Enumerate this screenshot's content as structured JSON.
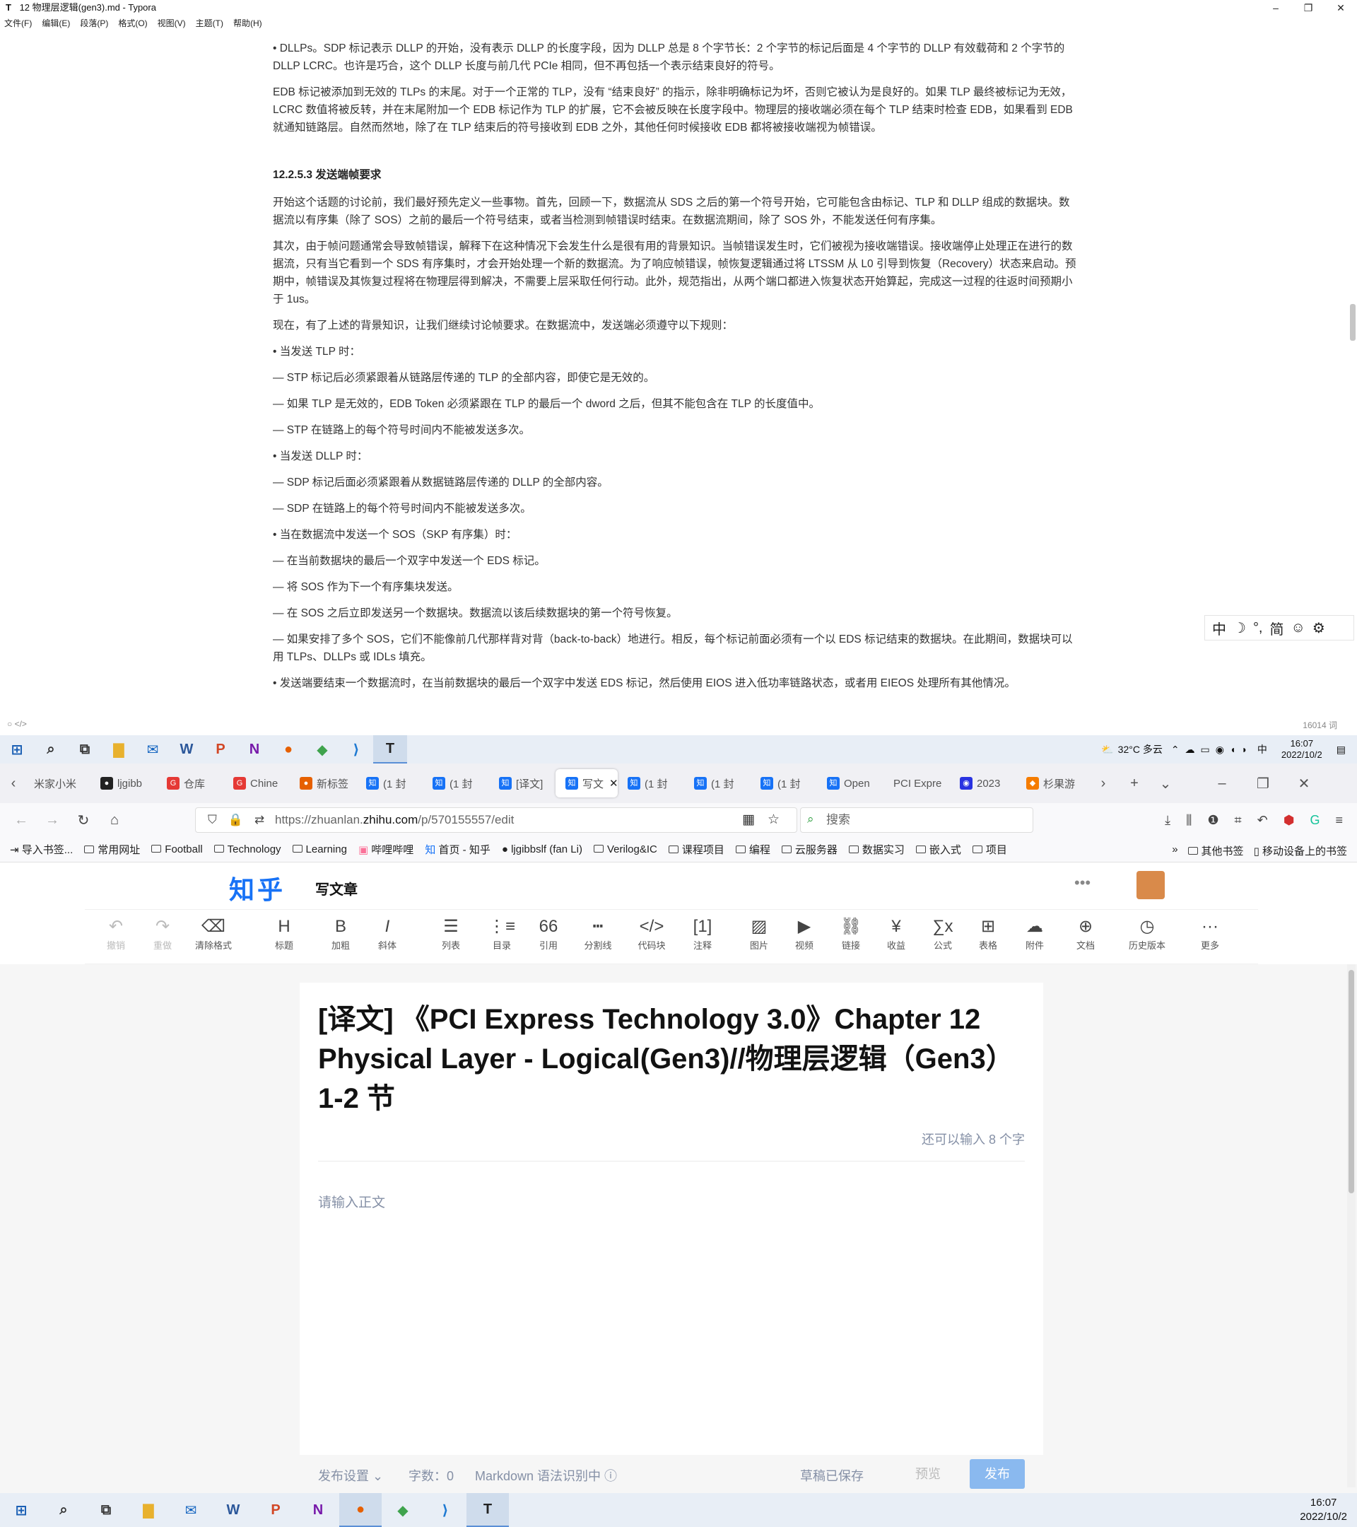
{
  "typora": {
    "title": "12 物理层逻辑(gen3).md - Typora",
    "menu": [
      "文件(F)",
      "编辑(E)",
      "段落(P)",
      "格式(O)",
      "视图(V)",
      "主题(T)",
      "帮助(H)"
    ],
    "paragraphs": [
      "• DLLPs。SDP 标记表示 DLLP 的开始，没有表示 DLLP 的长度字段，因为 DLLP 总是 8 个字节长：2 个字节的标记后面是 4 个字节的 DLLP 有效载荷和 2 个字节的 DLLP LCRC。也许是巧合，这个 DLLP 长度与前几代 PCIe 相同，但不再包括一个表示结束良好的符号。",
      "EDB 标记被添加到无效的 TLPs 的末尾。对于一个正常的 TLP，没有 “结束良好” 的指示，除非明确标记为坏，否则它被认为是良好的。如果 TLP 最终被标记为无效，LCRC 数值将被反转，并在末尾附加一个 EDB 标记作为 TLP 的扩展，它不会被反映在长度字段中。物理层的接收端必须在每个 TLP 结束时检查 EDB，如果看到 EDB 就通知链路层。自然而然地，除了在 TLP 结束后的符号接收到 EDB 之外，其他任何时候接收 EDB 都将被接收端视为帧错误。"
    ],
    "heading": "12.2.5.3 发送端帧要求",
    "paragraphs2": [
      "开始这个话题的讨论前，我们最好预先定义一些事物。首先，回顾一下，数据流从 SDS 之后的第一个符号开始，它可能包含由标记、TLP 和 DLLP 组成的数据块。数据流以有序集（除了 SOS）之前的最后一个符号结束，或者当检测到帧错误时结束。在数据流期间，除了 SOS 外，不能发送任何有序集。",
      "其次，由于帧问题通常会导致帧错误，解释下在这种情况下会发生什么是很有用的背景知识。当帧错误发生时，它们被视为接收端错误。接收端停止处理正在进行的数据流，只有当它看到一个 SDS 有序集时，才会开始处理一个新的数据流。为了响应帧错误，帧恢复逻辑通过将 LTSSM 从 L0 引导到恢复（Recovery）状态来启动。预期中，帧错误及其恢复过程将在物理层得到解决，不需要上层采取任何行动。此外，规范指出，从两个端口都进入恢复状态开始算起，完成这一过程的往返时间预期小于 1us。",
      "现在，有了上述的背景知识，让我们继续讨论帧要求。在数据流中，发送端必须遵守以下规则：",
      "• 当发送 TLP 时：",
      "— STP 标记后必须紧跟着从链路层传递的 TLP 的全部内容，即使它是无效的。",
      "— 如果 TLP 是无效的，EDB Token 必须紧跟在 TLP 的最后一个 dword 之后，但其不能包含在 TLP 的长度值中。",
      "— STP 在链路上的每个符号时间内不能被发送多次。",
      "• 当发送 DLLP 时：",
      "— SDP 标记后面必须紧跟着从数据链路层传递的 DLLP 的全部内容。",
      "— SDP 在链路上的每个符号时间内不能被发送多次。",
      "• 当在数据流中发送一个 SOS（SKP 有序集）时：",
      "— 在当前数据块的最后一个双字中发送一个 EDS 标记。",
      "— 将 SOS 作为下一个有序集块发送。",
      "— 在 SOS 之后立即发送另一个数据块。数据流以该后续数据块的第一个符号恢复。",
      "— 如果安排了多个 SOS，它们不能像前几代那样背对背（back-to-back）地进行。相反，每个标记前面必须有一个以 EDS 标记结束的数据块。在此期间，数据块可以用 TLPs、DLLPs 或 IDLs 填充。",
      "• 发送端要结束一个数据流时，在当前数据块的最后一个双字中发送 EDS 标记，然后使用 EIOS 进入低功率链路状态，或者用 EIEOS 处理所有其他情况。"
    ],
    "ime": [
      "中",
      "☽",
      "°,",
      "简",
      "☺",
      "⚙"
    ],
    "status_left": "○   </>",
    "word_count": "16014 词"
  },
  "taskbar_top": {
    "weather": "32°C 多云",
    "lang": "中",
    "time": "16:07",
    "date": "2022/10/2"
  },
  "browser": {
    "tabs": [
      "米家小米",
      "ljgibb",
      "仓库",
      "Chine",
      "新标签",
      "(1 封",
      "(1 封",
      "[译文]",
      "写文",
      "(1 封",
      "(1 封",
      "(1 封",
      "Open",
      "PCI Expre",
      "2023",
      "杉果游"
    ],
    "url_prefix": "https://zhuanlan.",
    "url_domain": "zhihu.com",
    "url_path": "/p/570155557/edit",
    "search_placeholder": "搜索",
    "bookmarks": [
      "导入书签...",
      "常用网址",
      "Football",
      "Technology",
      "Learning",
      "哔哩哔哩",
      "首页 - 知乎",
      "ljgibbslf (fan Li)",
      "Verilog&IC",
      "课程项目",
      "编程",
      "云服务器",
      "数据实习",
      "嵌入式",
      "项目"
    ],
    "bookmarks_right": [
      "其他书签",
      "移动设备上的书签"
    ]
  },
  "zhihu": {
    "logo": "知乎",
    "write": "写文章",
    "toolbar": [
      "撤销",
      "重做",
      "清除格式",
      "标题",
      "加粗",
      "斜体",
      "列表",
      "目录",
      "引用",
      "分割线",
      "代码块",
      "注释",
      "图片",
      "视频",
      "链接",
      "收益",
      "公式",
      "表格",
      "附件",
      "文档",
      "历史版本",
      "更多"
    ],
    "title": "[译文] 《PCI Express Technology 3.0》Chapter 12 Physical Layer - Logical(Gen3)//物理层逻辑（Gen3）1-2 节",
    "char_remaining": "还可以输入 8 个字",
    "body_placeholder": "请输入正文",
    "publish_settings": "发布设置 ⌄",
    "word_count": "字数：0",
    "markdown": "Markdown 语法识别中 ⓘ",
    "saved": "草稿已保存",
    "preview": "预览",
    "publish": "发布"
  },
  "taskbar_bottom": {
    "time": "16:07",
    "date": "2022/10/2"
  },
  "colors": {
    "zhihu_blue": "#1772f6",
    "publish_btn": "#8ab9ef",
    "taskbar": "#e8eef6"
  }
}
